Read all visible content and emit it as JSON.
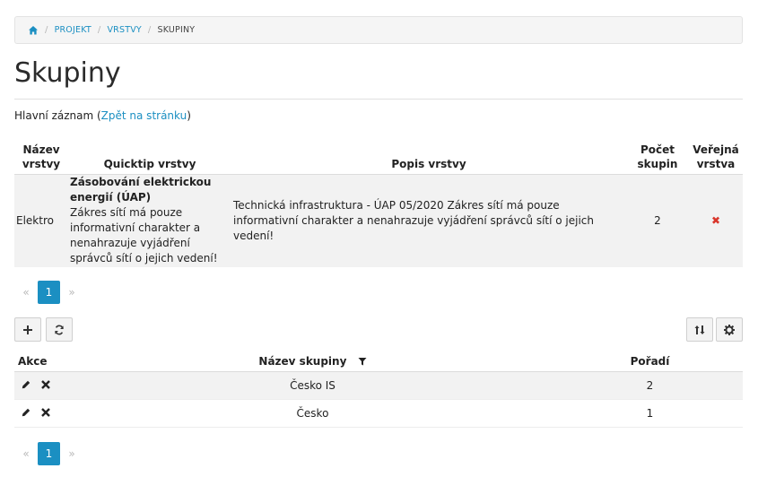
{
  "breadcrumb": {
    "home_icon": "home-icon",
    "items": [
      "PROJEKT",
      "VRSTVY"
    ],
    "current": "SKUPINY",
    "separator": "/"
  },
  "page": {
    "title": "Skupiny"
  },
  "master": {
    "prefix": "Hlavní záznam (",
    "link": "Zpět na stránku",
    "suffix": ")"
  },
  "layer_table": {
    "headers": {
      "name_line1": "Název",
      "name_line2": "vrstvy",
      "quicktip": "Quicktip vrstvy",
      "desc": "Popis vrstvy",
      "count_line1": "Počet",
      "count_line2": "skupin",
      "public_line1": "Veřejná",
      "public_line2": "vrstva"
    },
    "row": {
      "name": "Elektro",
      "quicktip_title": "Zásobování elektrickou energií (ÚAP)",
      "quicktip_text": "Zákres sítí má pouze informativní charakter a nenahrazuje vyjádření správců sítí o jejich vedení!",
      "desc": "Technická infrastruktura - ÚAP 05/2020 Zákres sítí má pouze informativní charakter a nenahrazuje vyjádření správců sítí o jejich vedení!",
      "count": "2",
      "public": "✖",
      "public_color": "#d9362b"
    }
  },
  "pagination_top": {
    "prev": "«",
    "page": "1",
    "next": "»"
  },
  "toolbar": {
    "add_icon": "plus-icon",
    "refresh_icon": "refresh-icon",
    "sort_icon": "sort-icon",
    "settings_icon": "gear-icon"
  },
  "group_table": {
    "headers": {
      "actions": "Akce",
      "name": "Název skupiny",
      "order": "Pořadí"
    },
    "rows": [
      {
        "name": "Česko IS",
        "order": "2"
      },
      {
        "name": "Česko",
        "order": "1"
      }
    ]
  },
  "pagination_bottom": {
    "prev": "«",
    "page": "1",
    "next": "»"
  },
  "colors": {
    "accent": "#1b8fc2",
    "danger": "#d9362b"
  }
}
